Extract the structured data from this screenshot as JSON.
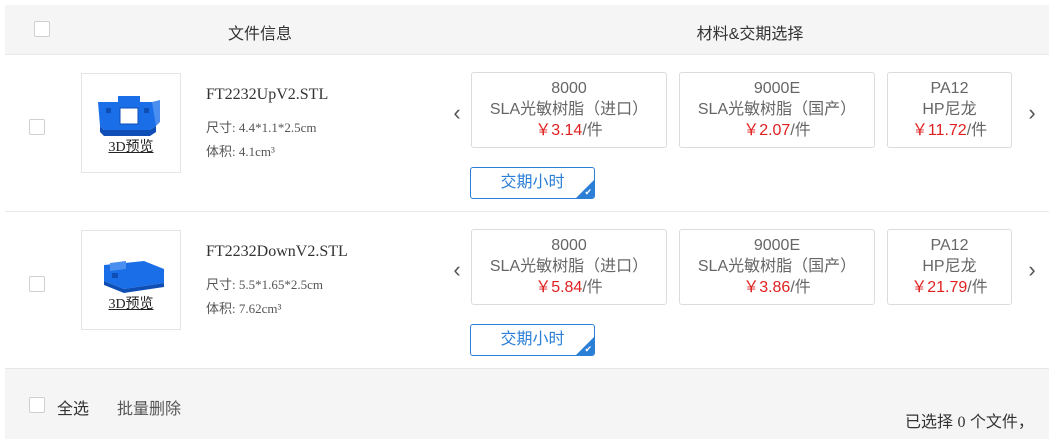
{
  "header": {
    "file_info": "文件信息",
    "material_lead": "材料&交期选择"
  },
  "rows": [
    {
      "name": "FT2232UpV2.STL",
      "size": "尺寸: 4.4*1.1*2.5cm",
      "volume": "体积: 4.1cm³",
      "preview": "3D预览",
      "materials": [
        {
          "code": "8000",
          "desc": "SLA光敏树脂（进口）",
          "price": "￥3.14",
          "unit": "/件"
        },
        {
          "code": "9000E",
          "desc": "SLA光敏树脂（国产）",
          "price": "￥2.07",
          "unit": "/件"
        },
        {
          "code": "PA12",
          "desc": "HP尼龙",
          "price": "￥11.72",
          "unit": "/件"
        }
      ],
      "lead_time": "交期小时"
    },
    {
      "name": "FT2232DownV2.STL",
      "size": "尺寸: 5.5*1.65*2.5cm",
      "volume": "体积: 7.62cm³",
      "preview": "3D预览",
      "materials": [
        {
          "code": "8000",
          "desc": "SLA光敏树脂（进口）",
          "price": "￥5.84",
          "unit": "/件"
        },
        {
          "code": "9000E",
          "desc": "SLA光敏树脂（国产）",
          "price": "￥3.86",
          "unit": "/件"
        },
        {
          "code": "PA12",
          "desc": "HP尼龙",
          "price": "￥21.79",
          "unit": "/件"
        }
      ],
      "lead_time": "交期小时"
    }
  ],
  "nav": {
    "prev_icon": "chevron-left-icon",
    "next_icon": "chevron-right-icon",
    "prev_glyph": "‹",
    "next_glyph": "›"
  },
  "footer": {
    "select_all": "全选",
    "batch_delete": "批量删除",
    "selected_prefix": "已选择",
    "selected_count": "0",
    "selected_suffix": "个文件，"
  },
  "colors": {
    "accent": "#2b7fd6",
    "price": "#e02020",
    "model": "#1a6fe8"
  }
}
